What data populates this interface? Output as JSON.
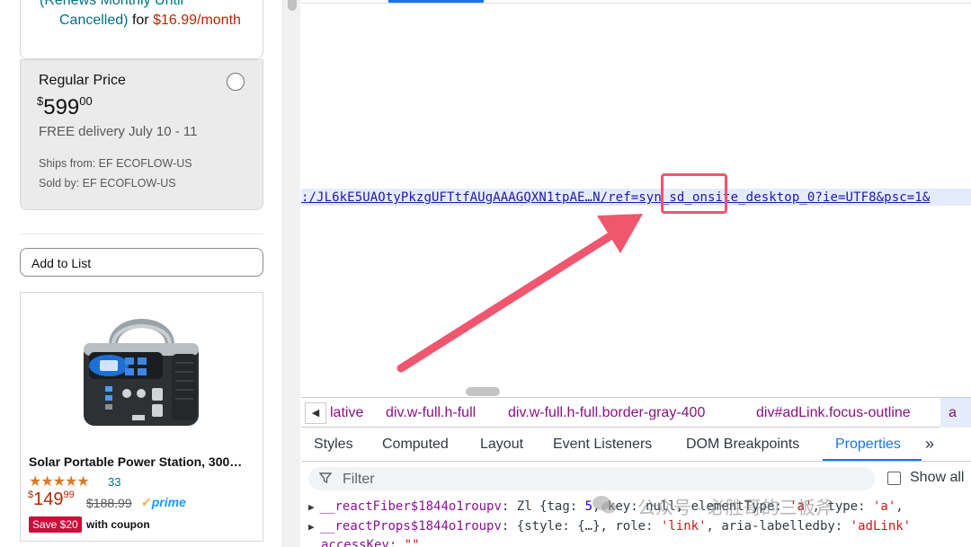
{
  "subscription": {
    "renew_text": "(Renews Monthly Until",
    "cancelled_text": "Cancelled)",
    "for_text": "for",
    "price_text": "$16.99/month"
  },
  "regular": {
    "title": "Regular Price",
    "price_symbol": "$",
    "price_whole": "599",
    "price_fraction": "00",
    "delivery": "FREE delivery July 10 - 11",
    "ships_from": "Ships from: EF ECOFLOW-US",
    "sold_by": "Sold by: EF ECOFLOW-US",
    "selected": false
  },
  "add_to_list": "Add to List",
  "ad": {
    "title": "Solar Portable Power Station, 300…",
    "stars": "★★★★★",
    "rating": 4.5,
    "review_count": "33",
    "price_symbol": "$",
    "price_whole": "149",
    "price_fraction": "99",
    "list_price": "$188.99",
    "prime_check": "✓",
    "prime_label": "prime",
    "coupon_badge": "Save $20",
    "coupon_text": "with coupon"
  },
  "devtools": {
    "selected_node_url": ":/JL6kE5UAOtyPkzgUFTtfAUgAAAGQXN1tpAE…N/ref=syn_sd_onsite_desktop_0?ie=UTF8&psc=1&",
    "breadcrumbs": [
      "lative",
      "div.w-full.h-full",
      "div.w-full.h-full.border-gray-400",
      "div#adLink.focus-outline",
      "a"
    ],
    "tabs": [
      "Styles",
      "Computed",
      "Layout",
      "Event Listeners",
      "DOM Breakpoints",
      "Properties"
    ],
    "active_tab": "Properties",
    "more_tabs": "»",
    "filter_placeholder": "Filter",
    "show_all_label": "Show all",
    "properties": [
      {
        "key": "__reactFiber$1844o1roupv",
        "value_prefix": ": Zl {tag: ",
        "num": "5",
        "value_mid": ", key: null, elementType: ",
        "str1": "'a'",
        "value_end": ", type: ",
        "str2": "'a'",
        "tail": ", "
      },
      {
        "key": "__reactProps$1844o1roupv",
        "value_prefix": ": {style: {…}, role: ",
        "str1": "'link'",
        "value_mid": ", aria-labelledby: ",
        "str2": "'adLink'",
        "tail": ""
      },
      {
        "key": "accessKey",
        "value_prefix": ": ",
        "str1": "\"\""
      }
    ]
  },
  "watermark": "公众号 · 必胜哥的三板斧",
  "colors": {
    "annotation": "#f0566e",
    "devtools_accent": "#1a73e8",
    "link_teal": "#007185",
    "price_red": "#b12704"
  }
}
